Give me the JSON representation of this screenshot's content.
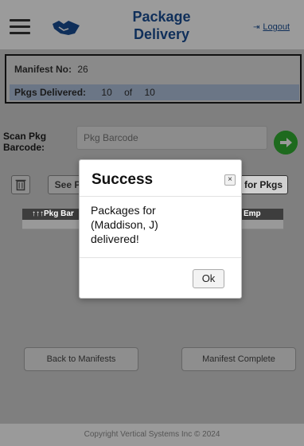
{
  "header": {
    "title_line1": "Package",
    "title_line2": "Delivery",
    "logout_label": "Logout",
    "menu_icon": "hamburger-icon",
    "brand_icon": "handshake-icon",
    "logout_icon": "sign-out-icon"
  },
  "manifest": {
    "no_label": "Manifest No:",
    "no_value": "26",
    "pkgs_label": "Pkgs Delivered:",
    "delivered": "10",
    "of_label": "of",
    "total": "10"
  },
  "scan": {
    "label_line1": "Scan Pkg",
    "label_line2": "Barcode:",
    "placeholder": "Pkg Barcode",
    "go_icon": "arrow-right-circle-icon"
  },
  "table": {
    "trash_icon": "trash-icon",
    "see_label": "See P",
    "pkgs_label": "for Pkgs",
    "col_pkg": "↑↑↑Pkg Bar",
    "col_emp": "Emp"
  },
  "buttons": {
    "back": "Back to Manifests",
    "complete": "Manifest Complete"
  },
  "footer": {
    "copyright": "Copyright Vertical Systems Inc © 2024"
  },
  "modal": {
    "title": "Success",
    "close_icon": "close-icon",
    "close_glyph": "×",
    "message_line1": "Packages for",
    "message_line2": "(Maddison, J)",
    "message_line3": "delivered!",
    "ok_label": "Ok"
  },
  "colors": {
    "accent": "#0f2f5a",
    "go_button": "#1e6a1e",
    "pkgs_row": "#6b7686"
  }
}
